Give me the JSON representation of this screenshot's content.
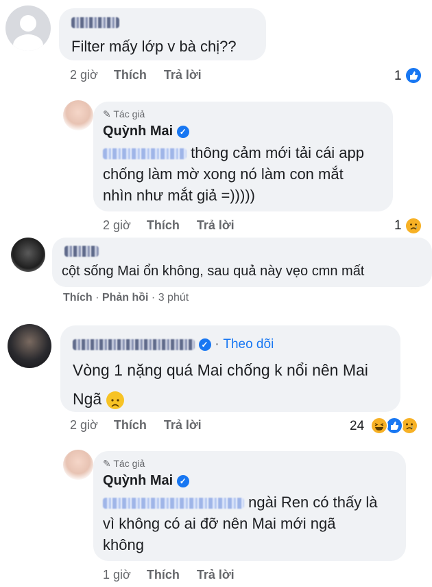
{
  "comments": [
    {
      "name": "Minh P.",
      "text": "Filter mấy lớp v bà chị??",
      "time": "2 giờ",
      "like": "Thích",
      "reply": "Trả lời",
      "reaction_count": "1"
    },
    {
      "author_badge": "Tác giả",
      "name": "Quỳnh Mai",
      "mention": "N...",
      "line1": "thông cảm mới tải cái app",
      "line2": "chống làm mờ xong nó làm con mắt",
      "line3": "nhìn như mắt giả =)))))",
      "time": "2 giờ",
      "like": "Thích",
      "reply": "Trả lời",
      "reaction_count": "1"
    },
    {
      "name": "",
      "text": "cột sống Mai ổn không, sau quả này vẹo cmn mất",
      "like": "Thích",
      "reply": "Phản hồi",
      "time": "3 phút",
      "separator": "·"
    },
    {
      "name": "",
      "follow": "Theo dõi",
      "line1": "Vòng 1 nặng quá Mai chống k nổi nên Mai",
      "line2": "Ngã",
      "time": "2 giờ",
      "like": "Thích",
      "reply": "Trả lời",
      "reaction_count": "24"
    },
    {
      "author_badge": "Tác giả",
      "name": "Quỳnh Mai",
      "line1": "ngài Ren có thấy là",
      "line2": "vì không có ai đỡ nên Mai mới ngã",
      "line3": "không",
      "time": "1 giờ",
      "like": "Thích",
      "reply": "Trả lời"
    }
  ],
  "colors": {
    "bubble": "#f0f2f5",
    "link": "#1877f2",
    "meta": "#65676b"
  },
  "icons": [
    "default-avatar-icon",
    "like-reaction-icon",
    "sad-reaction-icon",
    "haha-reaction-icon",
    "verified-icon",
    "pencil-icon",
    "frown-emoji-icon"
  ]
}
